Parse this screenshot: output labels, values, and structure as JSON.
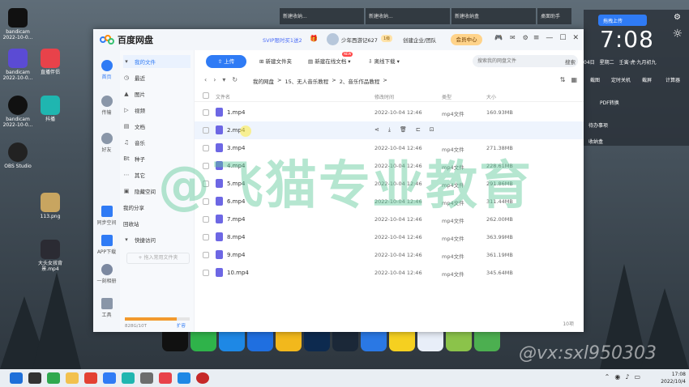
{
  "desktop": {
    "icons": [
      {
        "label": "bandicam 2022-10-0..."
      },
      {
        "label": "bandicam 2022-10-0..."
      },
      {
        "label": "直播伴侣"
      },
      {
        "label": "bandicam 2022-10-0..."
      },
      {
        "label": "抖播"
      },
      {
        "label": "OBS Studio"
      },
      {
        "label": "113.png"
      },
      {
        "label": "大头女孩背景.mp4"
      }
    ],
    "top_windows": [
      "新建收纳...",
      "新建收纳...",
      "新建收纳盒"
    ],
    "clock": "7:08",
    "sync_button": "拖拽上传",
    "assistant": "桌面助手",
    "date_line": [
      "04日",
      "星期二",
      "壬寅·虎·九月初九"
    ],
    "tools": [
      "截图",
      "定时关机",
      "截屏",
      "计算器"
    ],
    "pdf": "PDF转换",
    "todo": "待办事项",
    "box": "收纳盒",
    "watermark": "@vx:sxl950303",
    "brand_watermark": "@飞猫专业教育"
  },
  "window": {
    "logo": "百度网盘",
    "svip_promo": "SVIP限时买1送2",
    "username": "少年西游记627",
    "level": "1级",
    "business": "创建企业/团队",
    "member_center": "会员中心",
    "nav": [
      {
        "label": "首页"
      },
      {
        "label": "传输"
      },
      {
        "label": "好友"
      },
      {
        "label": "同步空间"
      },
      {
        "label": "APP下载"
      },
      {
        "label": "一刻相册"
      },
      {
        "label": "工具"
      }
    ],
    "sidebar": {
      "my_files": "我的文件",
      "items": [
        "最近",
        "图片",
        "视频",
        "文档",
        "音乐",
        "种子",
        "其它",
        "隐藏空间"
      ],
      "my_share": "我的分享",
      "recycle": "回收站",
      "quick_access": "快捷访问",
      "add_fav": "+ 拖入常用文件夹",
      "quota_text": "828G/10T",
      "expand": "扩容"
    },
    "toolbar": {
      "upload": "上传",
      "new_folder": "新建文件夹",
      "new_online_doc": "新建在线文档",
      "new_badge": "NEW",
      "offline_download": "离线下载",
      "search_placeholder": "搜索我的网盘文件",
      "search_label": "搜索"
    },
    "breadcrumb": [
      "我的网盘",
      "15、无人音乐教程",
      "2、音乐作品教程"
    ],
    "columns": {
      "name": "文件名",
      "modified": "修改时间",
      "type": "类型",
      "size": "大小"
    },
    "files": [
      {
        "name": "1.mp4",
        "time": "2022-10-04 12:46",
        "type": "mp4文件",
        "size": "160.93MB"
      },
      {
        "name": "2.mp4",
        "time": "",
        "type": "",
        "size": ""
      },
      {
        "name": "3.mp4",
        "time": "2022-10-04 12:46",
        "type": "mp4文件",
        "size": "271.38MB"
      },
      {
        "name": "4.mp4",
        "time": "2022-10-04 12:46",
        "type": "mp4文件",
        "size": "228.61MB"
      },
      {
        "name": "5.mp4",
        "time": "2022-10-04 12:46",
        "type": "mp4文件",
        "size": "291.86MB"
      },
      {
        "name": "6.mp4",
        "time": "2022-10-04 12:46",
        "type": "mp4文件",
        "size": "311.44MB"
      },
      {
        "name": "7.mp4",
        "time": "2022-10-04 12:46",
        "type": "mp4文件",
        "size": "262.00MB"
      },
      {
        "name": "8.mp4",
        "time": "2022-10-04 12:46",
        "type": "mp4文件",
        "size": "363.99MB"
      },
      {
        "name": "9.mp4",
        "time": "2022-10-04 12:46",
        "type": "mp4文件",
        "size": "361.19MB"
      },
      {
        "name": "10.mp4",
        "time": "2022-10-04 12:46",
        "type": "mp4文件",
        "size": "345.64MB"
      }
    ],
    "item_count": "10项"
  },
  "taskbar": {
    "time": "17:08",
    "date": "2022/10/4"
  },
  "colors": {
    "accent": "#2f7bf5",
    "video_file": "#6d67e4",
    "quota": "#f29a2e"
  }
}
